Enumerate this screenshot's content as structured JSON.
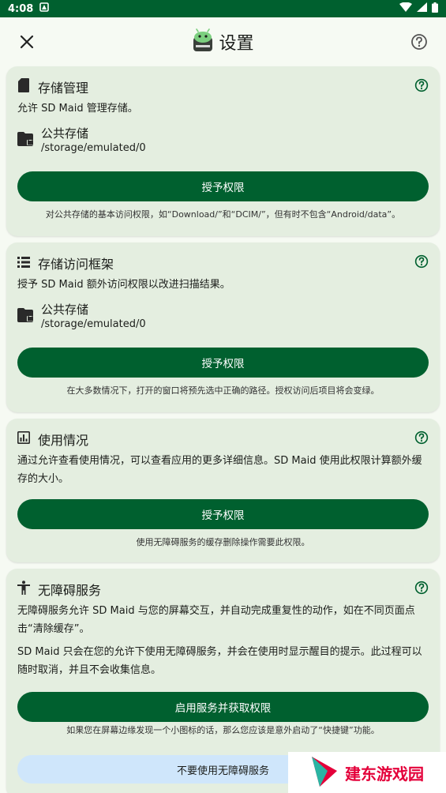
{
  "status_bar": {
    "time": "4:08"
  },
  "header": {
    "title": "设置"
  },
  "cards": [
    {
      "title": "存储管理",
      "description": "允许 SD Maid 管理存储。",
      "path_title": "公共存储",
      "path_value": "/storage/emulated/0",
      "button": "授予权限",
      "note": "对公共存储的基本访问权限，如“Download/”和“DCIM/”，但有时不包含“Android/data”。"
    },
    {
      "title": "存储访问框架",
      "description": "授予 SD Maid 额外访问权限以改进扫描结果。",
      "path_title": "公共存储",
      "path_value": "/storage/emulated/0",
      "button": "授予权限",
      "note": "在大多数情况下，打开的窗口将预先选中正确的路径。授权访问后项目将会变绿。"
    },
    {
      "title": "使用情况",
      "description": "通过允许查看使用情况，可以查看应用的更多详细信息。SD Maid 使用此权限计算额外缓存的大小。",
      "button": "授予权限",
      "note": "使用无障碍服务的缓存删除操作需要此权限。"
    },
    {
      "title": "无障碍服务",
      "description": "无障碍服务允许 SD Maid 与您的屏幕交互，并自动完成重复性的动作，如在不同页面点击“清除缓存”。",
      "description2": "SD Maid 只会在您的允许下使用无障碍服务，并会在使用时显示醒目的提示。此过程可以随时取消，并且不会收集信息。",
      "button": "启用服务并获取权限",
      "note": "如果您在屏幕边缘发现一个小图标的话，那么您应该是意外启动了“快捷键”功能。",
      "secondary_button": "不要使用无障碍服务"
    }
  ],
  "watermark": {
    "text": "建东游戏园"
  },
  "colors": {
    "primary": "#00602f",
    "card_bg": "#e4eee0",
    "secondary_button": "#cfe6fb",
    "help_icon": "#00602f",
    "watermark_text": "#e4003a"
  }
}
